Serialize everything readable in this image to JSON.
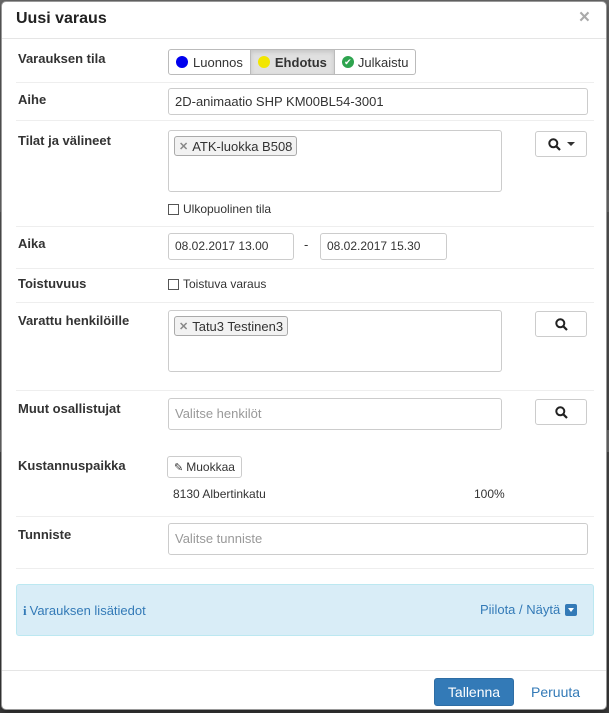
{
  "dialog": {
    "title": "Uusi varaus",
    "close_icon": "×"
  },
  "status": {
    "label": "Varauksen tila",
    "options": [
      {
        "label": "Luonnos",
        "color": "#0000ee"
      },
      {
        "label": "Ehdotus",
        "color": "#f2e600",
        "selected": true
      },
      {
        "label": "Julkaistu",
        "color": "#2ea44f"
      }
    ]
  },
  "subject": {
    "label": "Aihe",
    "value": "2D-animaatio SHP KM00BL54-3001"
  },
  "rooms": {
    "label": "Tilat ja välineet",
    "tags": [
      "ATK-luokka B508"
    ],
    "external_label": "Ulkopuolinen tila"
  },
  "time": {
    "label": "Aika",
    "start": "08.02.2017 13.00",
    "separator": "-",
    "end": "08.02.2017 15.30"
  },
  "recurrence": {
    "label": "Toistuvuus",
    "checkbox_label": "Toistuva varaus"
  },
  "reserved_for": {
    "label": "Varattu henkilöille",
    "tags": [
      "Tatu3 Testinen3"
    ]
  },
  "other_participants": {
    "label": "Muut osallistujat",
    "placeholder": "Valitse henkilöt"
  },
  "cost_center": {
    "label": "Kustannuspaikka",
    "edit_label": "Muokkaa",
    "name": "8130 Albertinkatu",
    "percent": "100%"
  },
  "identifier": {
    "label": "Tunniste",
    "placeholder": "Valitse tunniste"
  },
  "details": {
    "label": "Varauksen lisätiedot",
    "toggle_label": "Piilota / Näytä"
  },
  "footer": {
    "save_label": "Tallenna",
    "cancel_label": "Peruuta"
  }
}
